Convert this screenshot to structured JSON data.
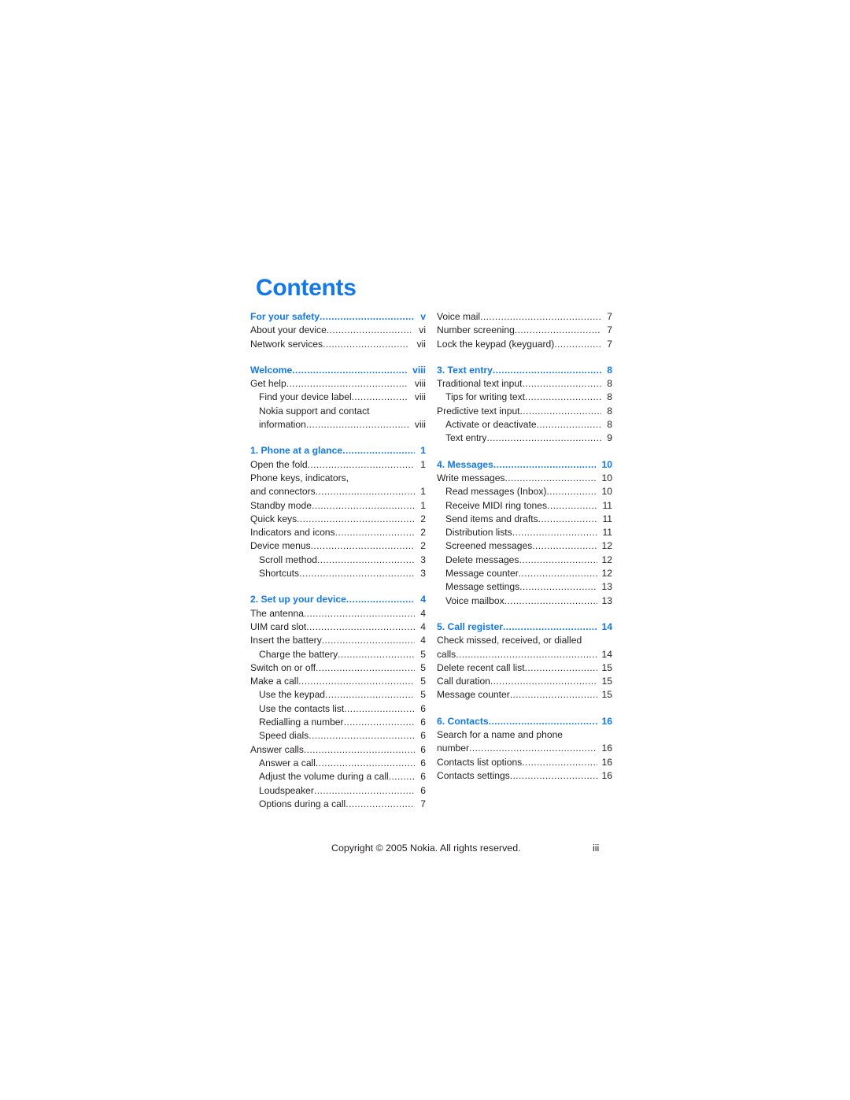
{
  "document": {
    "heading": "Contents",
    "accent_color": "#1479e8",
    "text_color": "#231f20",
    "background_color": "#ffffff"
  },
  "footer": {
    "copyright": "Copyright © 2005 Nokia. All rights reserved.",
    "page_number": "iii"
  },
  "toc": {
    "left_column": [
      {
        "entries": [
          {
            "label": "For your safety",
            "page": "v",
            "level": 1,
            "section": true,
            "leader": true
          },
          {
            "label": "About your device",
            "page": "vi",
            "level": 1,
            "section": false,
            "leader": true
          },
          {
            "label": "Network services",
            "page": "vii",
            "level": 1,
            "section": false,
            "leader": true
          }
        ]
      },
      {
        "entries": [
          {
            "label": "Welcome",
            "page": "viii",
            "level": 1,
            "section": true,
            "leader": true
          },
          {
            "label": "Get help",
            "page": "viii",
            "level": 1,
            "section": false,
            "leader": true
          },
          {
            "label": "Find your device label",
            "page": "viii",
            "level": 2,
            "section": false,
            "leader": true
          },
          {
            "label": "Nokia support and contact",
            "page": "",
            "level": 2,
            "section": false,
            "leader": false
          },
          {
            "label": "information",
            "page": "viii",
            "level": 2,
            "section": false,
            "leader": true,
            "continuation": true
          }
        ]
      },
      {
        "entries": [
          {
            "label": "1. Phone at a glance",
            "page": "1",
            "level": 1,
            "section": true,
            "leader": true
          },
          {
            "label": "Open the fold",
            "page": "1",
            "level": 1,
            "section": false,
            "leader": true
          },
          {
            "label": "Phone keys, indicators,",
            "page": "",
            "level": 1,
            "section": false,
            "leader": false
          },
          {
            "label": "and connectors",
            "page": "1",
            "level": 1,
            "section": false,
            "leader": true,
            "continuation": true
          },
          {
            "label": "Standby mode",
            "page": "1",
            "level": 1,
            "section": false,
            "leader": true
          },
          {
            "label": "Quick keys",
            "page": "2",
            "level": 1,
            "section": false,
            "leader": true
          },
          {
            "label": "Indicators and icons",
            "page": "2",
            "level": 1,
            "section": false,
            "leader": true
          },
          {
            "label": "Device menus",
            "page": "2",
            "level": 1,
            "section": false,
            "leader": true
          },
          {
            "label": "Scroll method",
            "page": "3",
            "level": 2,
            "section": false,
            "leader": true
          },
          {
            "label": "Shortcuts",
            "page": "3",
            "level": 2,
            "section": false,
            "leader": true
          }
        ]
      },
      {
        "entries": [
          {
            "label": "2. Set up your device",
            "page": "4",
            "level": 1,
            "section": true,
            "leader": true
          },
          {
            "label": "The antenna",
            "page": "4",
            "level": 1,
            "section": false,
            "leader": true
          },
          {
            "label": "UIM card slot",
            "page": "4",
            "level": 1,
            "section": false,
            "leader": true
          },
          {
            "label": "Insert the battery",
            "page": "4",
            "level": 1,
            "section": false,
            "leader": true
          },
          {
            "label": "Charge the battery",
            "page": "5",
            "level": 2,
            "section": false,
            "leader": true
          },
          {
            "label": "Switch on or off",
            "page": "5",
            "level": 1,
            "section": false,
            "leader": true
          },
          {
            "label": "Make a call",
            "page": "5",
            "level": 1,
            "section": false,
            "leader": true
          },
          {
            "label": "Use the keypad",
            "page": "5",
            "level": 2,
            "section": false,
            "leader": true
          },
          {
            "label": "Use the contacts list",
            "page": "6",
            "level": 2,
            "section": false,
            "leader": true
          },
          {
            "label": "Redialling a number",
            "page": "6",
            "level": 2,
            "section": false,
            "leader": true
          },
          {
            "label": "Speed dials",
            "page": "6",
            "level": 2,
            "section": false,
            "leader": true
          },
          {
            "label": "Answer calls",
            "page": "6",
            "level": 1,
            "section": false,
            "leader": true
          },
          {
            "label": "Answer a call",
            "page": "6",
            "level": 2,
            "section": false,
            "leader": true
          },
          {
            "label": "Adjust the volume during a call",
            "page": "6",
            "level": 2,
            "section": false,
            "leader": true
          },
          {
            "label": "Loudspeaker",
            "page": "6",
            "level": 2,
            "section": false,
            "leader": true
          },
          {
            "label": "Options during a call",
            "page": "7",
            "level": 2,
            "section": false,
            "leader": true
          }
        ]
      }
    ],
    "right_column": [
      {
        "entries": [
          {
            "label": "Voice mail",
            "page": "7",
            "level": 1,
            "section": false,
            "leader": true
          },
          {
            "label": "Number screening",
            "page": "7",
            "level": 1,
            "section": false,
            "leader": true
          },
          {
            "label": "Lock the keypad (keyguard)",
            "page": "7",
            "level": 1,
            "section": false,
            "leader": true
          }
        ]
      },
      {
        "entries": [
          {
            "label": "3. Text entry",
            "page": "8",
            "level": 1,
            "section": true,
            "leader": true
          },
          {
            "label": "Traditional text input",
            "page": "8",
            "level": 1,
            "section": false,
            "leader": true
          },
          {
            "label": "Tips for writing text",
            "page": "8",
            "level": 2,
            "section": false,
            "leader": true
          },
          {
            "label": "Predictive text input",
            "page": "8",
            "level": 1,
            "section": false,
            "leader": true
          },
          {
            "label": "Activate or deactivate",
            "page": "8",
            "level": 2,
            "section": false,
            "leader": true
          },
          {
            "label": "Text entry",
            "page": "9",
            "level": 2,
            "section": false,
            "leader": true
          }
        ]
      },
      {
        "entries": [
          {
            "label": "4. Messages",
            "page": "10",
            "level": 1,
            "section": true,
            "leader": true
          },
          {
            "label": "Write messages",
            "page": "10",
            "level": 1,
            "section": false,
            "leader": true
          },
          {
            "label": "Read messages (Inbox)",
            "page": "10",
            "level": 2,
            "section": false,
            "leader": true
          },
          {
            "label": "Receive MIDI ring tones",
            "page": "11",
            "level": 2,
            "section": false,
            "leader": true
          },
          {
            "label": "Send items and drafts",
            "page": "11",
            "level": 2,
            "section": false,
            "leader": true
          },
          {
            "label": "Distribution lists",
            "page": "11",
            "level": 2,
            "section": false,
            "leader": true
          },
          {
            "label": "Screened messages",
            "page": "12",
            "level": 2,
            "section": false,
            "leader": true
          },
          {
            "label": "Delete messages",
            "page": "12",
            "level": 2,
            "section": false,
            "leader": true
          },
          {
            "label": "Message counter",
            "page": "12",
            "level": 2,
            "section": false,
            "leader": true
          },
          {
            "label": "Message settings",
            "page": "13",
            "level": 2,
            "section": false,
            "leader": true
          },
          {
            "label": "Voice mailbox",
            "page": "13",
            "level": 2,
            "section": false,
            "leader": true
          }
        ]
      },
      {
        "entries": [
          {
            "label": "5. Call register",
            "page": "14",
            "level": 1,
            "section": true,
            "leader": true
          },
          {
            "label": "Check missed, received, or dialled",
            "page": "",
            "level": 1,
            "section": false,
            "leader": false
          },
          {
            "label": "calls",
            "page": "14",
            "level": 1,
            "section": false,
            "leader": true,
            "continuation": true
          },
          {
            "label": "Delete recent call list",
            "page": "15",
            "level": 1,
            "section": false,
            "leader": true
          },
          {
            "label": "Call duration",
            "page": "15",
            "level": 1,
            "section": false,
            "leader": true
          },
          {
            "label": "Message counter",
            "page": "15",
            "level": 1,
            "section": false,
            "leader": true
          }
        ]
      },
      {
        "entries": [
          {
            "label": "6. Contacts",
            "page": "16",
            "level": 1,
            "section": true,
            "leader": true
          },
          {
            "label": "Search for a name and phone",
            "page": "",
            "level": 1,
            "section": false,
            "leader": false
          },
          {
            "label": "number",
            "page": "16",
            "level": 1,
            "section": false,
            "leader": true,
            "continuation": true
          },
          {
            "label": "Contacts list options",
            "page": "16",
            "level": 1,
            "section": false,
            "leader": true
          },
          {
            "label": "Contacts settings",
            "page": "16",
            "level": 1,
            "section": false,
            "leader": true
          }
        ]
      }
    ]
  }
}
